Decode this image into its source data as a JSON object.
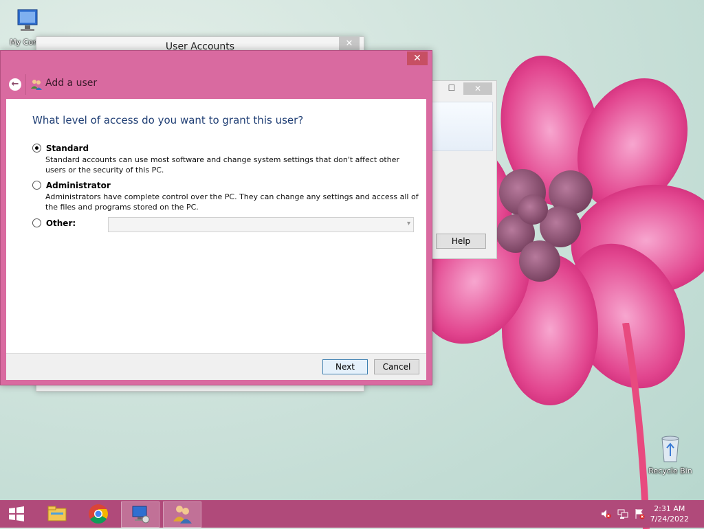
{
  "desktop": {
    "icons": [
      {
        "label": "My Comp"
      },
      {
        "label": "Recycle Bin"
      }
    ]
  },
  "bg_window": {
    "title": "User Accounts",
    "close_glyph": "✕"
  },
  "bg_window2": {
    "maximize_glyph": "☐",
    "close_glyph": "✕",
    "help_label": "Help"
  },
  "dialog": {
    "close_glyph": "✕",
    "back_glyph": "←",
    "nav_title": "Add a user",
    "heading": "What level of access do you want to grant this user?",
    "options": [
      {
        "label": "Standard",
        "selected": true,
        "description": "Standard accounts can use most software and change system settings that don't affect other users or the security of this PC."
      },
      {
        "label": "Administrator",
        "selected": false,
        "description": "Administrators have complete control over the PC. They can change any settings and access all of the files and programs stored on the PC."
      },
      {
        "label": "Other:",
        "selected": false,
        "description": ""
      }
    ],
    "other_select_value": "",
    "buttons": {
      "next": "Next",
      "cancel": "Cancel"
    }
  },
  "taskbar": {
    "items": [
      "start-icon",
      "file-explorer-icon",
      "chrome-icon",
      "remote-desktop-icon",
      "user-accounts-icon"
    ],
    "clock_time": "2:31 AM",
    "clock_date": "7/24/2022"
  },
  "colors": {
    "accent": "#d96aa0",
    "taskbar": "#b04a7a",
    "heading": "#1f3e74"
  }
}
